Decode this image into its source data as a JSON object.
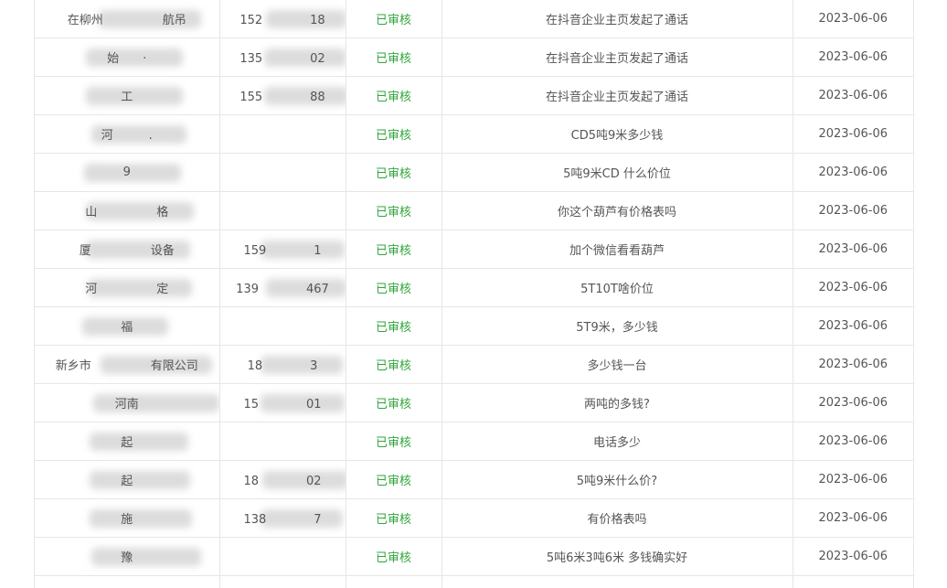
{
  "table": {
    "rows": [
      {
        "name": "在柳州　　　　　航吊",
        "phone": "152　　　　18",
        "status": "已审核",
        "message": "在抖音企业主页发起了通话",
        "date": "2023-06-06"
      },
      {
        "name": "始　　·",
        "phone": "135　　　　02",
        "status": "已审核",
        "message": "在抖音企业主页发起了通话",
        "date": "2023-06-06"
      },
      {
        "name": "工",
        "phone": "155　　　　88",
        "status": "已审核",
        "message": "在抖音企业主页发起了通话",
        "date": "2023-06-06"
      },
      {
        "name": "河　　　.",
        "phone": "",
        "status": "已审核",
        "message": "CD5吨9米多少钱",
        "date": "2023-06-06"
      },
      {
        "name": "9",
        "phone": "",
        "status": "已审核",
        "message": "5吨9米CD 什么价位",
        "date": "2023-06-06"
      },
      {
        "name": "山　　　　　格",
        "phone": "",
        "status": "已审核",
        "message": "你这个葫芦有价格表吗",
        "date": "2023-06-06"
      },
      {
        "name": "厦　　　　　设备",
        "phone": "159　　　　1",
        "status": "已审核",
        "message": "加个微信看看葫芦",
        "date": "2023-06-06"
      },
      {
        "name": "河　　　　　定",
        "phone": "139　　　　467",
        "status": "已审核",
        "message": "5T10T啥价位",
        "date": "2023-06-06"
      },
      {
        "name": "福",
        "phone": "",
        "status": "已审核",
        "message": "5T9米，多少钱",
        "date": "2023-06-06"
      },
      {
        "name": "新乡市　　　　　有限公司",
        "phone": "18　　　　3",
        "status": "已审核",
        "message": "多少钱一台",
        "date": "2023-06-06"
      },
      {
        "name": "河南　　　　　　",
        "phone": "15　　　　01",
        "status": "已审核",
        "message": "两吨的多钱?",
        "date": "2023-06-06"
      },
      {
        "name": "起　　　　",
        "phone": "",
        "status": "已审核",
        "message": "电话多少",
        "date": "2023-06-06"
      },
      {
        "name": "起　　　　",
        "phone": "18　　　　02",
        "status": "已审核",
        "message": "5吨9米什么价?",
        "date": "2023-06-06"
      },
      {
        "name": "施　　　",
        "phone": "138　　　　7",
        "status": "已审核",
        "message": "有价格表吗",
        "date": "2023-06-06"
      },
      {
        "name": "豫　　　　　",
        "phone": "",
        "status": "已审核",
        "message": "5吨6米3吨6米 多钱确实好",
        "date": "2023-06-06"
      },
      {
        "name": "",
        "phone": "",
        "status": "",
        "message": "",
        "date": ""
      }
    ]
  }
}
